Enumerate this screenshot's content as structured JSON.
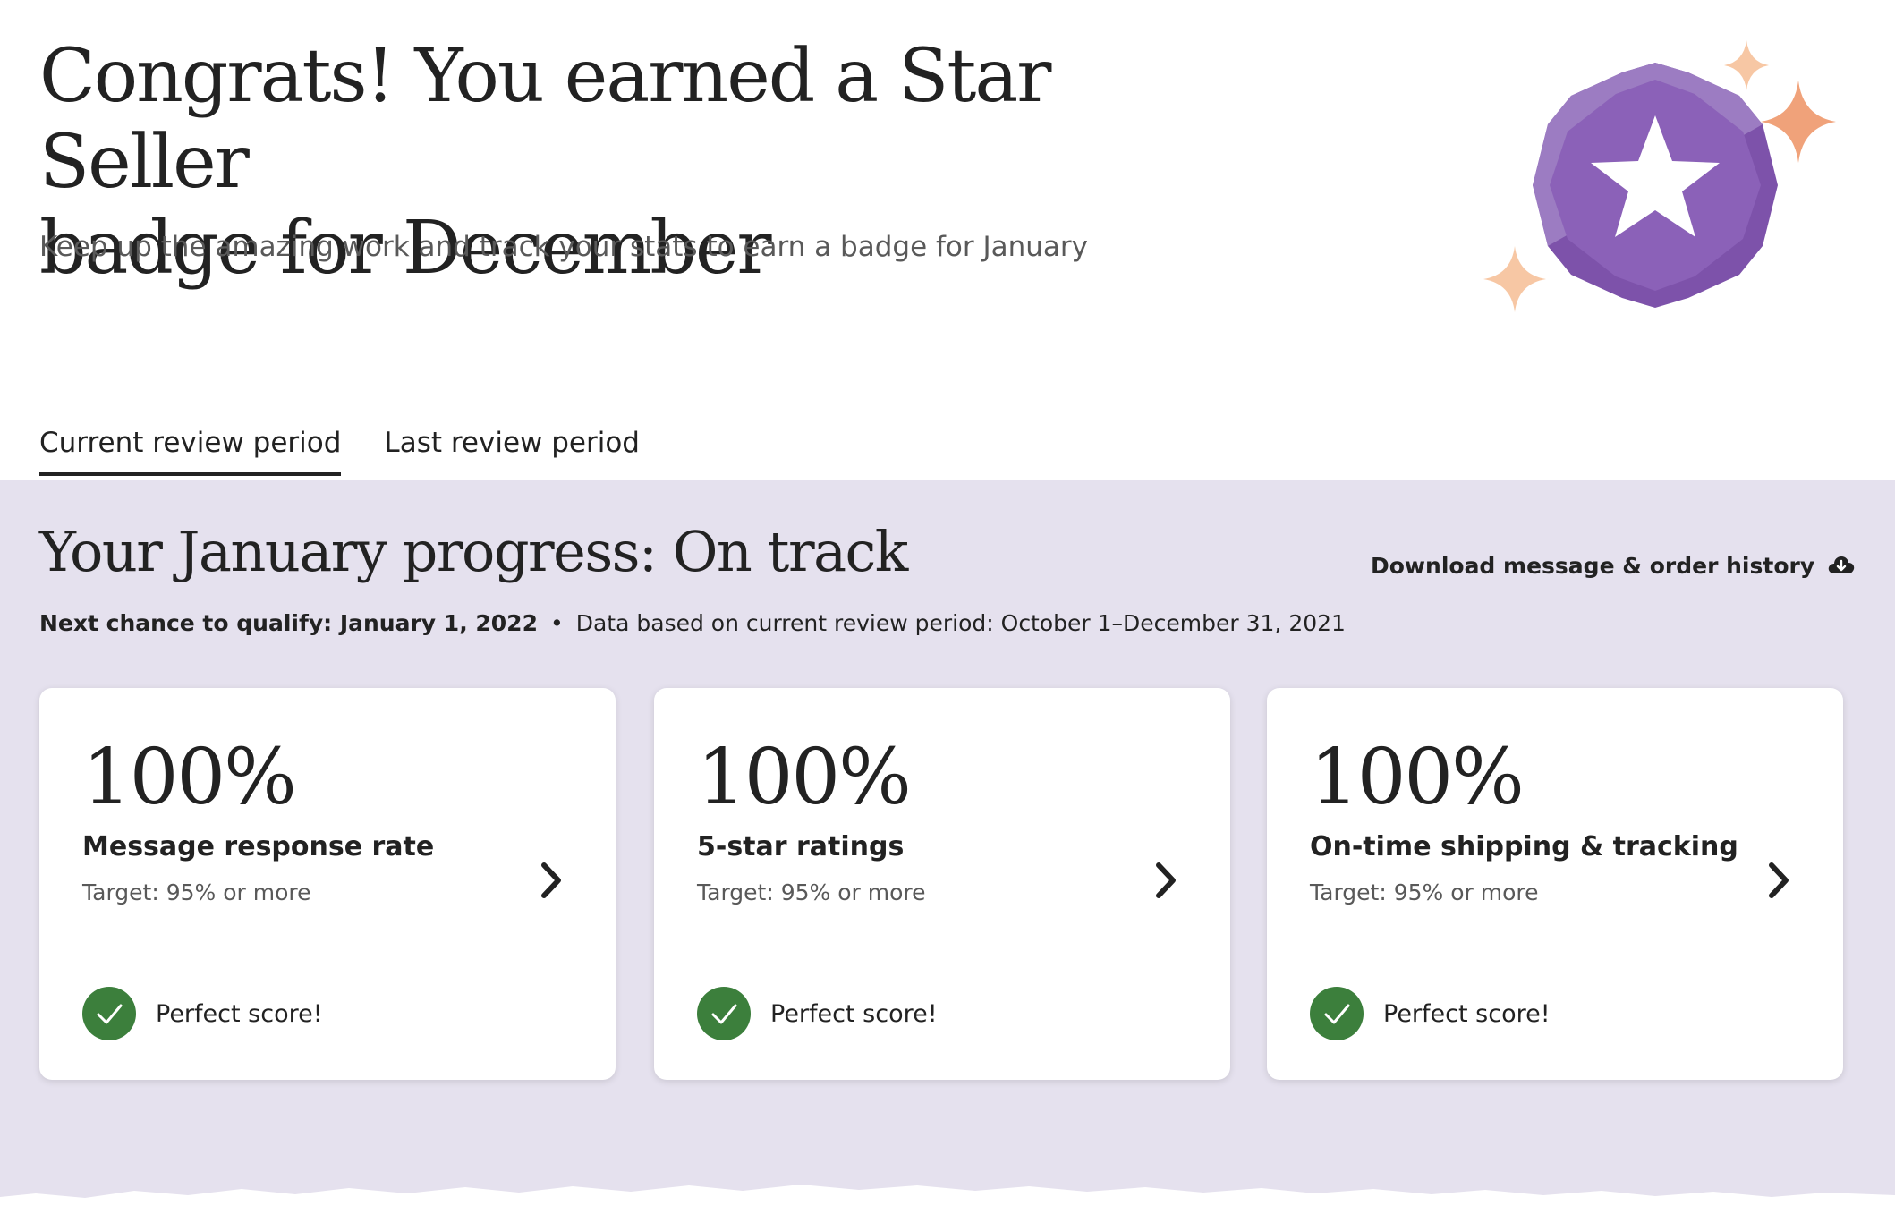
{
  "hero": {
    "title_line1": "Congrats! You earned a Star Seller",
    "title_line2": "badge for December",
    "subtitle": "Keep up the amazing work and track your stats to earn a badge for January"
  },
  "tabs": [
    {
      "label": "Current review period",
      "active": true
    },
    {
      "label": "Last review period",
      "active": false
    }
  ],
  "progress": {
    "title": "Your January progress: On track",
    "download_label": "Download message & order history",
    "next_chance": "Next chance to qualify: January 1, 2022",
    "separator": "•",
    "data_basis": "Data based on current review period: October 1–December 31, 2021"
  },
  "cards": [
    {
      "value": "100%",
      "label": "Message response rate",
      "target": "Target: 95% or more",
      "status": "Perfect score!"
    },
    {
      "value": "100%",
      "label": "5-star ratings",
      "target": "Target: 95% or more",
      "status": "Perfect score!"
    },
    {
      "value": "100%",
      "label": "On-time shipping & tracking",
      "target": "Target: 95% or more",
      "status": "Perfect score!"
    }
  ],
  "icons": {
    "badge": "star-seller-badge-icon",
    "sparkle": "sparkle-icon",
    "download": "cloud-download-icon",
    "chevron": "chevron-right-icon",
    "check": "check-circle-icon"
  },
  "colors": {
    "panel_bg": "#e5e1ee",
    "badge_purple": "#8d63b6",
    "sparkle_orange": "#f0a27a",
    "success_green": "#3c7f3c"
  }
}
